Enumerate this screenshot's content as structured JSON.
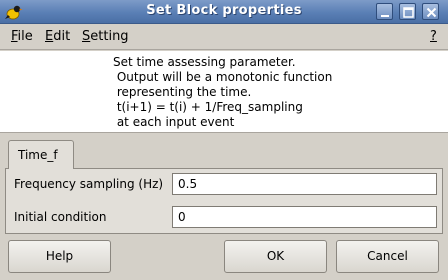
{
  "window": {
    "title": "Set Block properties",
    "icons": [
      "scilab-bird-icon",
      "minimize-icon",
      "maximize-icon",
      "close-icon"
    ]
  },
  "menubar": {
    "file": {
      "key": "F",
      "rest": "ile"
    },
    "edit": {
      "key": "E",
      "rest": "dit"
    },
    "setting": {
      "key": "S",
      "rest": "etting"
    },
    "help": {
      "key": "?"
    }
  },
  "description": [
    "Set time assessing parameter.",
    " Output will be a monotonic function",
    " representing the time.",
    " t(i+1) = t(i) + 1/Freq_sampling",
    " at each input event"
  ],
  "tabs": [
    {
      "label": "Time_f"
    }
  ],
  "fields": {
    "frequency": {
      "label": "Frequency sampling (Hz)",
      "value": "0.5"
    },
    "initial": {
      "label": "Initial condition",
      "value": "0"
    }
  },
  "buttons": {
    "help": "Help",
    "ok": "OK",
    "cancel": "Cancel"
  }
}
